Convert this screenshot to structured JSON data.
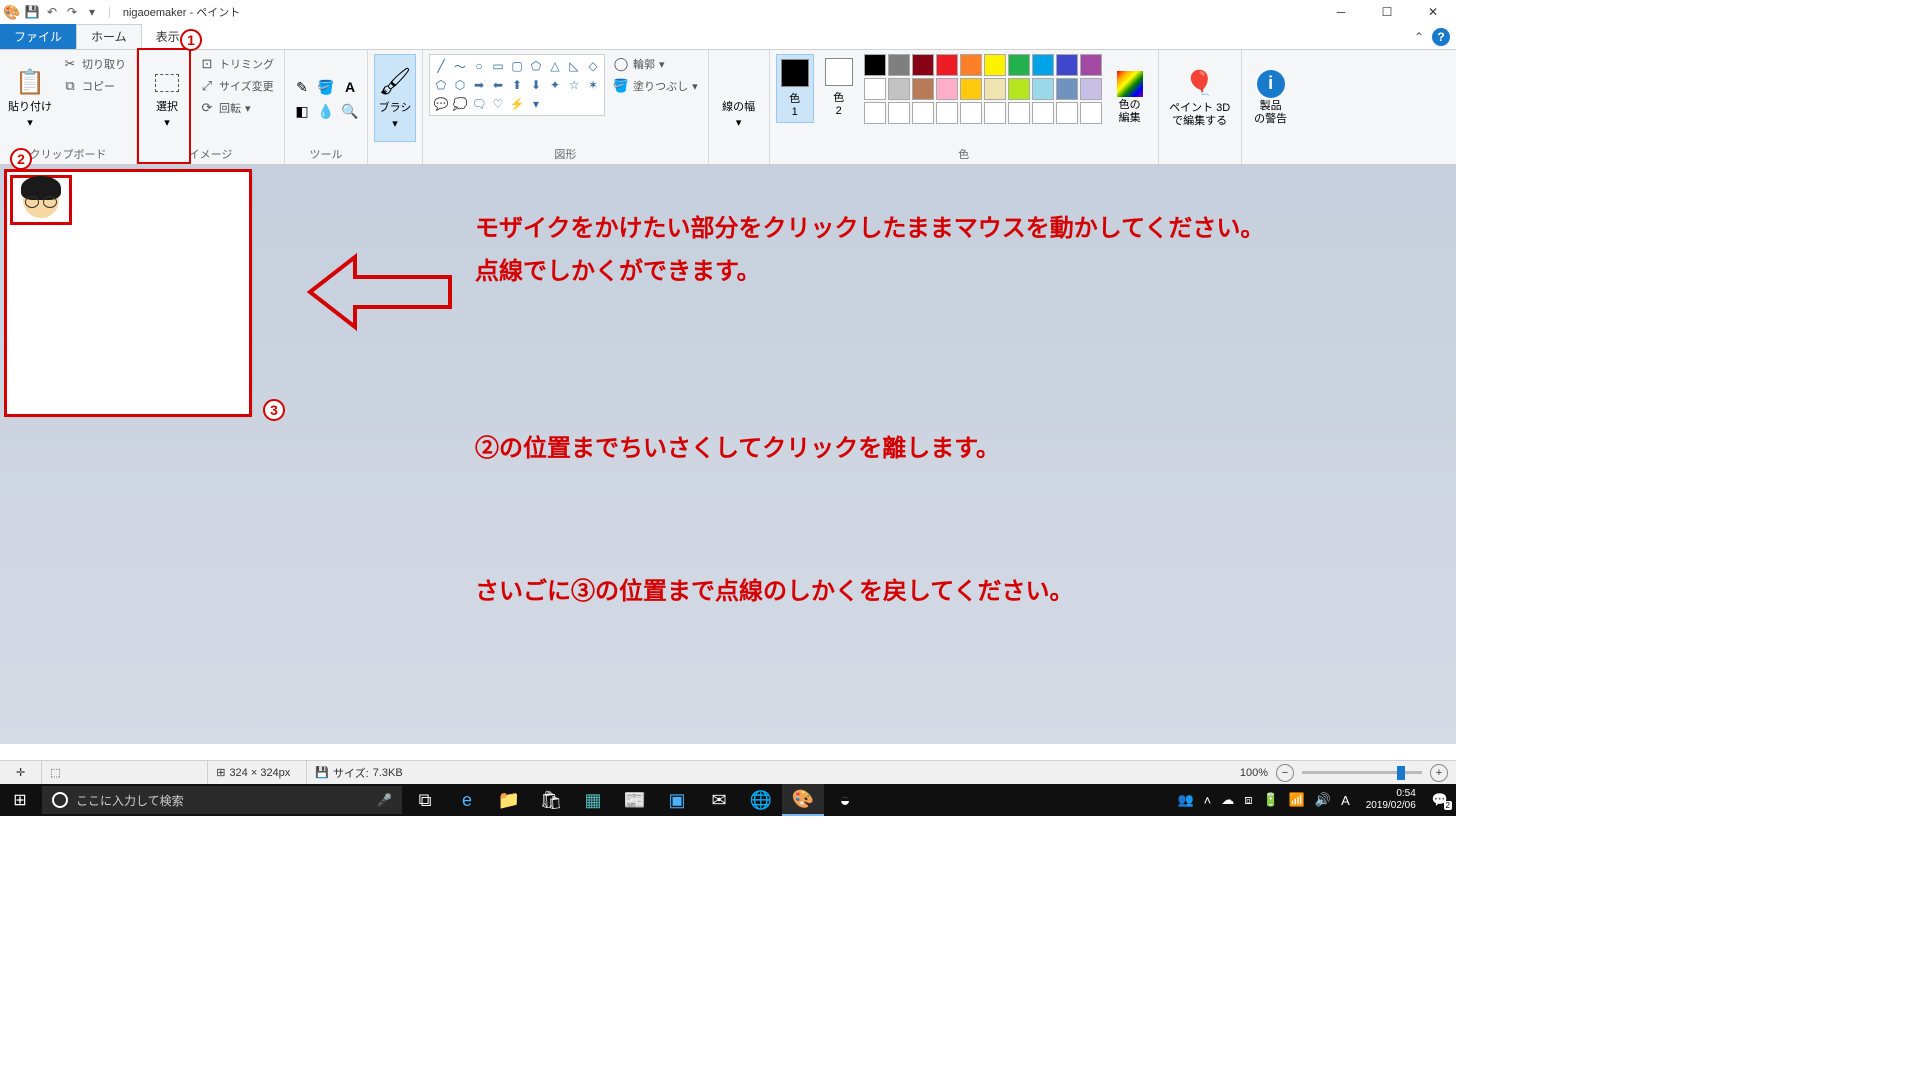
{
  "titlebar": {
    "app_title": "nigaoemaker - ペイント"
  },
  "tabs": {
    "file": "ファイル",
    "home": "ホーム",
    "view": "表示"
  },
  "ribbon": {
    "clipboard": {
      "label": "クリップボード",
      "paste": "貼り付け",
      "cut": "切り取り",
      "copy": "コピー"
    },
    "image": {
      "label": "イメージ",
      "select": "選択",
      "trim": "トリミング",
      "resize": "サイズ変更",
      "rotate": "回転"
    },
    "tools": {
      "label": "ツール"
    },
    "brush": {
      "label": "ブラシ"
    },
    "shapes": {
      "label": "図形",
      "outline": "輪郭",
      "fill": "塗りつぶし"
    },
    "linewidth": {
      "label": "線の幅"
    },
    "colors": {
      "label": "色",
      "color1": "色\n1",
      "color2": "色\n2",
      "edit": "色の\n編集"
    },
    "paint3d": {
      "label": "ペイント 3D\nで編集する"
    },
    "warning": {
      "label": "製品\nの警告"
    }
  },
  "annotations": {
    "num1": "1",
    "num2": "2",
    "num3": "3",
    "instruction1": "モザイクをかけたい部分をクリックしたままマウスを動かしてください。点線でしかくができます。",
    "instruction2": "②の位置までちいさくしてクリックを離します。",
    "instruction3": "さいごに③の位置まで点線のしかくを戻してください。"
  },
  "statusbar": {
    "dimensions": "324 × 324px",
    "size_label": "サイズ:",
    "size_value": "7.3KB",
    "zoom": "100%"
  },
  "taskbar": {
    "search_placeholder": "ここに入力して検索",
    "time": "0:54",
    "date": "2019/02/06",
    "notif_count": "2"
  },
  "colors": {
    "row1": [
      "#000000",
      "#7f7f7f",
      "#880015",
      "#ed1c24",
      "#ff7f27",
      "#fff200",
      "#22b14c",
      "#00a2e8",
      "#3f48cc",
      "#a349a4"
    ],
    "row2": [
      "#ffffff",
      "#c3c3c3",
      "#b97a57",
      "#ffaec9",
      "#ffc90e",
      "#efe4b0",
      "#b5e61d",
      "#99d9ea",
      "#7092be",
      "#c8bfe7"
    ],
    "color1_value": "#000000",
    "color2_value": "#ffffff"
  }
}
